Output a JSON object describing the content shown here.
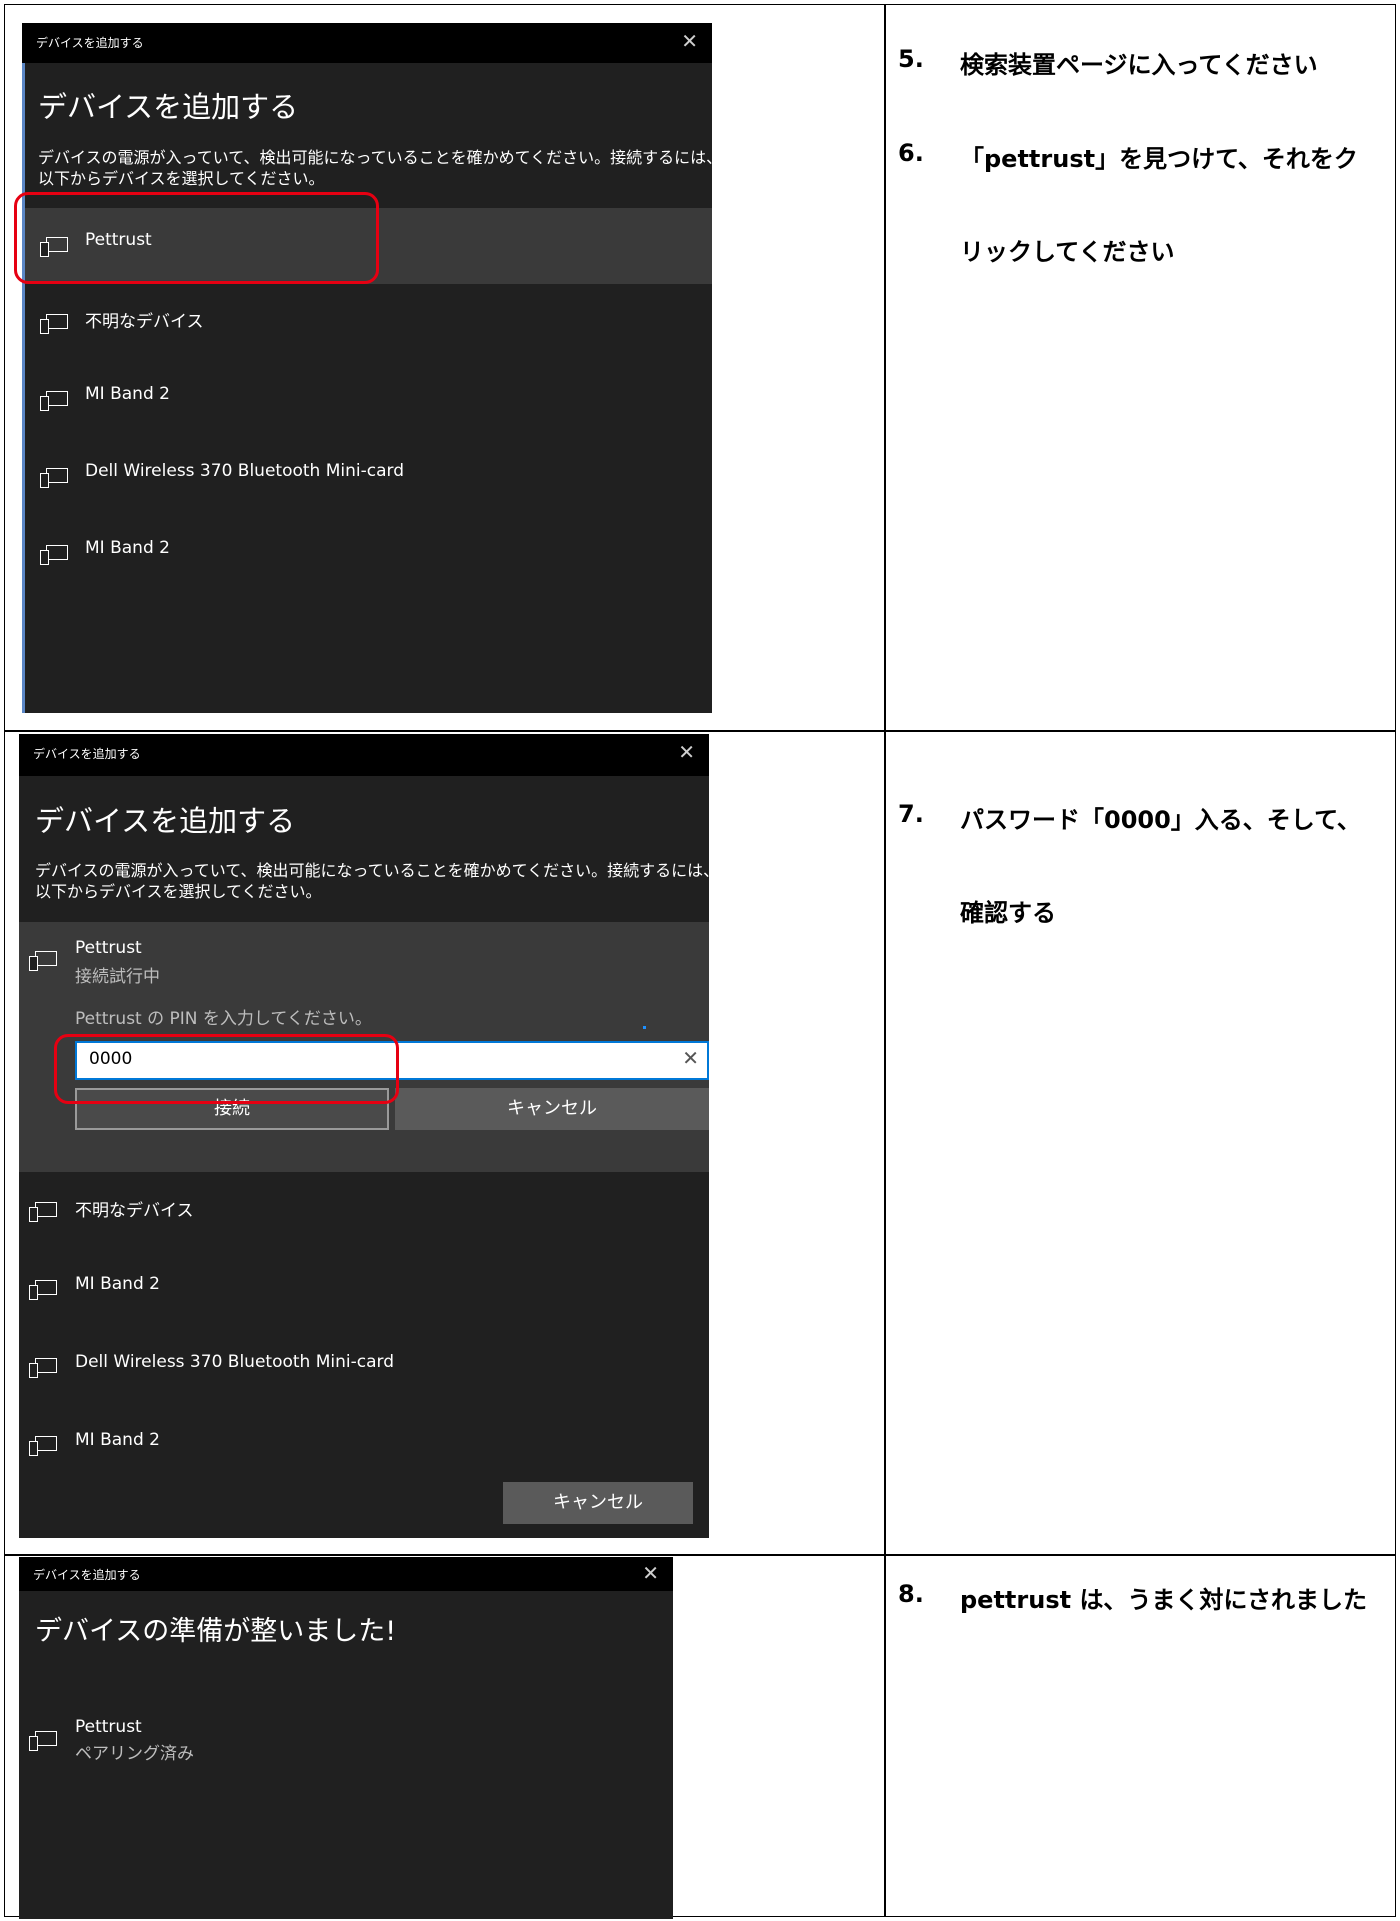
{
  "dialog_title": "デバイスを追加する",
  "dialog_heading": "デバイスを追加する",
  "dialog_description": "デバイスの電源が入っていて、検出可能になっていることを確かめてください。接続するには、以下からデバイスを選択してください。",
  "devices": [
    "Pettrust",
    "不明なデバイス",
    "MI Band 2",
    "Dell Wireless 370 Bluetooth Mini-card",
    "MI Band 2"
  ],
  "connecting_status": "接続試行中",
  "pin_prompt": "Pettrust の PIN を入力してください。",
  "pin_value": "0000",
  "connect_button": "接続",
  "cancel_button": "キャンセル",
  "footer_cancel_button": "キャンセル",
  "ready_heading": "デバイスの準備が整いました!",
  "ready_device": "Pettrust",
  "ready_status": "ペアリング済み",
  "steps": {
    "s5": {
      "num": "5.",
      "text": "検索装置ページに入ってください"
    },
    "s6": {
      "num": "6.",
      "text": "「pettrust」を見つけて、それをク",
      "text2": "リックしてください"
    },
    "s7": {
      "num": "7.",
      "text": "パスワード「0000」入る、そして、",
      "text2": "確認する"
    },
    "s8": {
      "num": "8.",
      "text": "pettrust は、うまく対にされました"
    }
  },
  "icons": {
    "device": "device-icon",
    "close": "close-icon",
    "clear": "clear-icon"
  },
  "colors": {
    "dialog_bg": "#202020",
    "titlebar_bg": "#000000",
    "highlight": "#e60012",
    "focus": "#0078d7"
  }
}
